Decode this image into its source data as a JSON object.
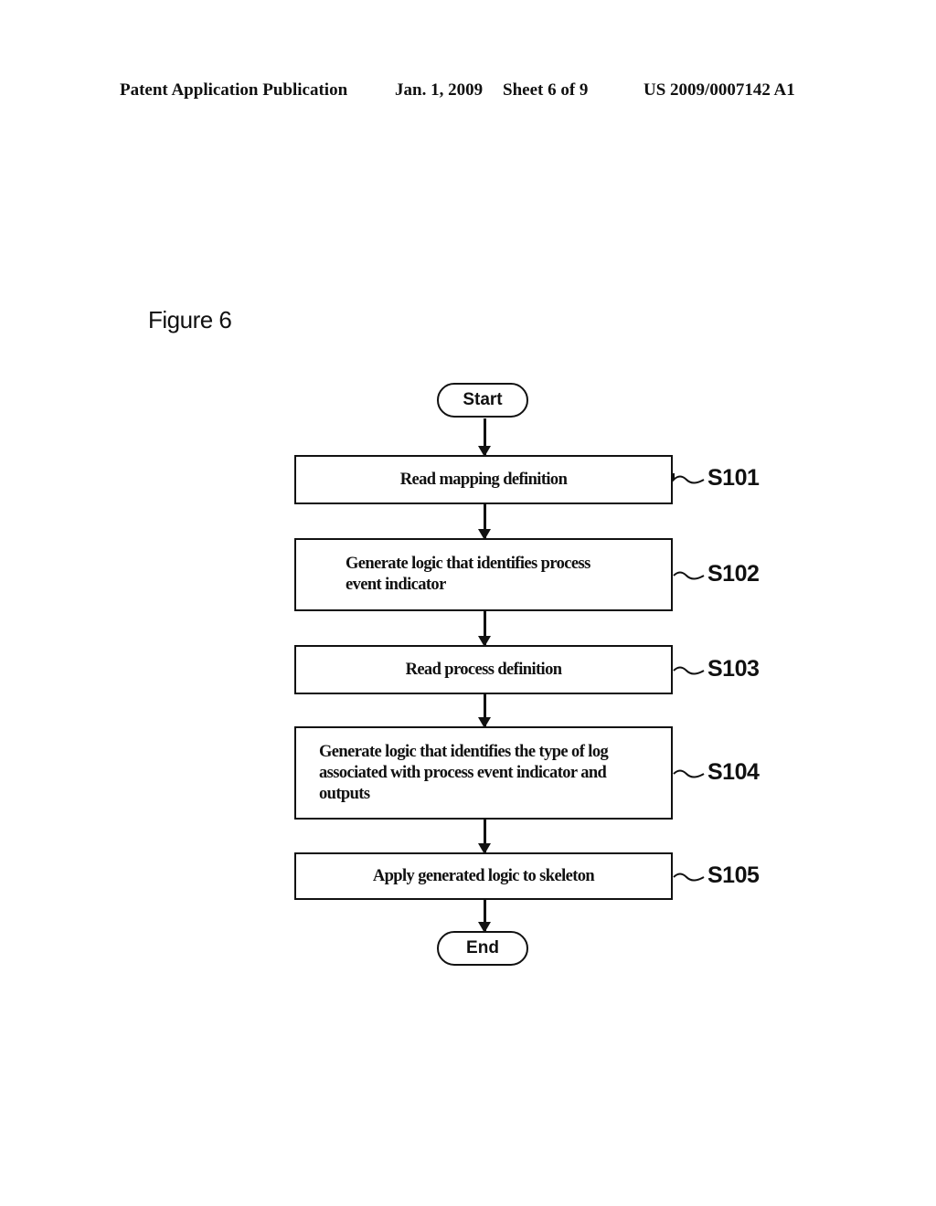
{
  "header": {
    "publication": "Patent Application Publication",
    "date": "Jan. 1, 2009",
    "sheet": "Sheet 6 of 9",
    "number": "US 2009/0007142 A1"
  },
  "figure": {
    "title": "Figure 6"
  },
  "flowchart": {
    "start": "Start",
    "end": "End",
    "steps": [
      {
        "id": "S101",
        "text": "Read mapping definition"
      },
      {
        "id": "S102",
        "text": "Generate logic that identifies process event indicator"
      },
      {
        "id": "S103",
        "text": "Read process definition"
      },
      {
        "id": "S104",
        "text": "Generate logic that identifies the type of log associated with process event indicator and outputs"
      },
      {
        "id": "S105",
        "text": "Apply generated logic to skeleton"
      }
    ]
  }
}
